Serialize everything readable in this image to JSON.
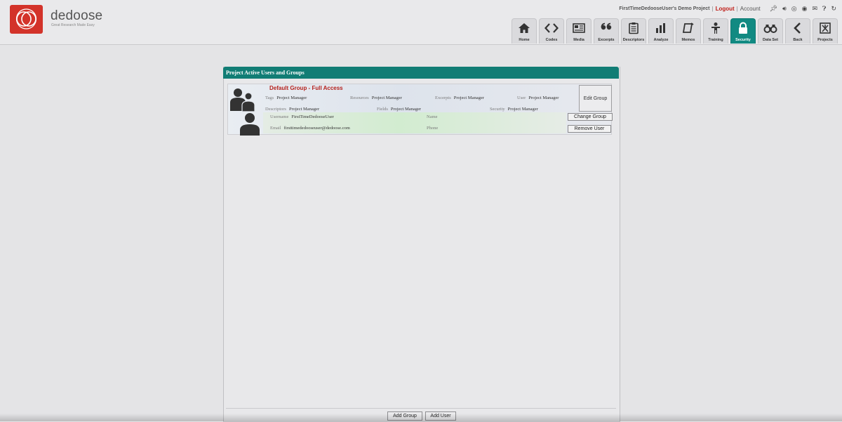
{
  "brand": {
    "name": "dedoose",
    "tagline": "Great Research Made Easy",
    "logo_color": "#d3332a"
  },
  "top_bar": {
    "project": "FirstTimeDedooseUser's Demo Project",
    "logout": "Logout",
    "account": "Account",
    "icons": [
      "pin-icon",
      "sound-icon",
      "toggle-icon",
      "toggle-icon",
      "mail-icon",
      "help-icon",
      "refresh-icon"
    ]
  },
  "toolbar": [
    {
      "label": "Home",
      "icon": "home-icon"
    },
    {
      "label": "Codes",
      "icon": "code-icon"
    },
    {
      "label": "Media",
      "icon": "media-icon"
    },
    {
      "label": "Excerpts",
      "icon": "quote-icon"
    },
    {
      "label": "Descriptors",
      "icon": "clipboard-icon"
    },
    {
      "label": "Analyze",
      "icon": "bar-chart-icon"
    },
    {
      "label": "Memos",
      "icon": "memo-icon"
    },
    {
      "label": "Training",
      "icon": "person-icon"
    },
    {
      "label": "Security",
      "icon": "lock-icon",
      "active": true
    },
    {
      "label": "Data Set",
      "icon": "binoculars-icon"
    },
    {
      "label": "Back",
      "icon": "chevron-left-icon"
    },
    {
      "label": "Projects",
      "icon": "projects-icon"
    }
  ],
  "accent_color": "#117d75",
  "panel": {
    "title": "Project Active Users and Groups",
    "group": {
      "title": "Default Group - Full Access",
      "permissions": {
        "tags_label": "Tags",
        "tags_value": "Project Manager",
        "resources_label": "Resources",
        "resources_value": "Project Manager",
        "excerpts_label": "Excerpts",
        "excerpts_value": "Project Manager",
        "user_label": "User",
        "user_value": "Project Manager",
        "descriptors_label": "Descriptors",
        "descriptors_value": "Project Manager",
        "fields_label": "Fields",
        "fields_value": "Project Manager",
        "security_label": "Security",
        "security_value": "Project Manager"
      },
      "edit_button": "Edit Group"
    },
    "user": {
      "username_label": "Username",
      "username": "FirstTimeDedooseUser",
      "email_label": "Email",
      "email": "firsttimededooseuser@dedoose.com",
      "name_label": "Name",
      "name": "",
      "phone_label": "Phone",
      "phone": "",
      "change_group_button": "Change Group",
      "remove_user_button": "Remove User"
    },
    "footer": {
      "add_group_button": "Add Group",
      "add_user_button": "Add User"
    }
  }
}
